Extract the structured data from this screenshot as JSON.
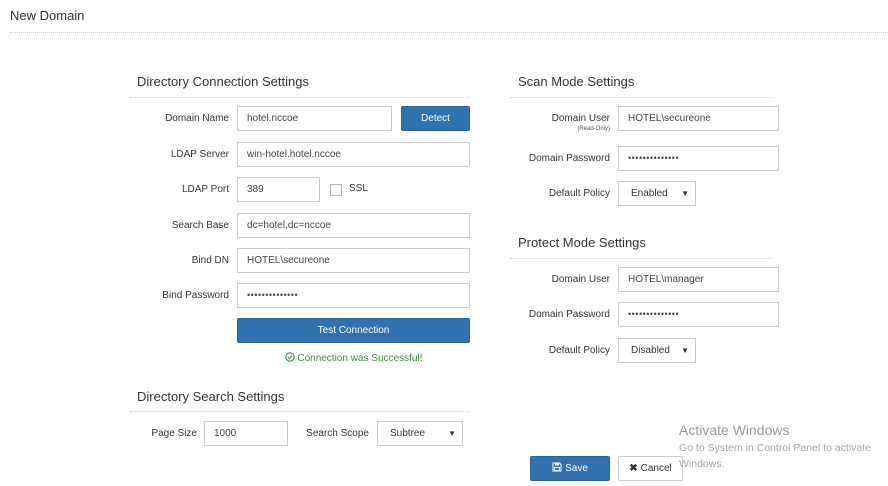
{
  "page": {
    "title": "New Domain"
  },
  "directory_connection": {
    "title": "Directory Connection Settings",
    "domain_name": {
      "label": "Domain Name",
      "value": "hotel.nccoe"
    },
    "detect_label": "Detect",
    "ldap_server": {
      "label": "LDAP Server",
      "value": "win-hotel.hotel.nccoe"
    },
    "ldap_port": {
      "label": "LDAP Port",
      "value": "389"
    },
    "ssl": {
      "label": "SSL",
      "checked": false
    },
    "search_base": {
      "label": "Search Base",
      "value": "dc=hotel,dc=nccoe"
    },
    "bind_dn": {
      "label": "Bind DN",
      "value": "HOTEL\\secureone"
    },
    "bind_password": {
      "label": "Bind Password",
      "value": "••••••••••••••"
    },
    "test_connection_label": "Test Connection",
    "status_text": "Connection was Successful!"
  },
  "directory_search": {
    "title": "Directory Search Settings",
    "page_size": {
      "label": "Page Size",
      "value": "1000"
    },
    "search_scope": {
      "label": "Search Scope",
      "value": "Subtree"
    }
  },
  "scan_mode": {
    "title": "Scan Mode Settings",
    "domain_user": {
      "label": "Domain User",
      "sublabel": "(Read-Only)",
      "value": "HOTEL\\secureone"
    },
    "domain_password": {
      "label": "Domain Password",
      "value": "••••••••••••••"
    },
    "default_policy": {
      "label": "Default Policy",
      "value": "Enabled"
    }
  },
  "protect_mode": {
    "title": "Protect Mode Settings",
    "domain_user": {
      "label": "Domain User",
      "value": "HOTEL\\manager"
    },
    "domain_password": {
      "label": "Domain Password",
      "value": "••••••••••••••"
    },
    "default_policy": {
      "label": "Default Policy",
      "value": "Disabled"
    }
  },
  "actions": {
    "save_label": "Save",
    "cancel_label": "Cancel"
  },
  "watermark": {
    "title": "Activate Windows",
    "line1": "Go to System in Control Panel to activate",
    "line2": "Windows."
  },
  "icons": {
    "save": "floppy-disk-icon",
    "cancel": "times-icon",
    "success": "check-circle-icon",
    "dropdown": "caret-down-icon"
  },
  "colors": {
    "primary": "#3071b0",
    "success": "#3c8d3c"
  }
}
